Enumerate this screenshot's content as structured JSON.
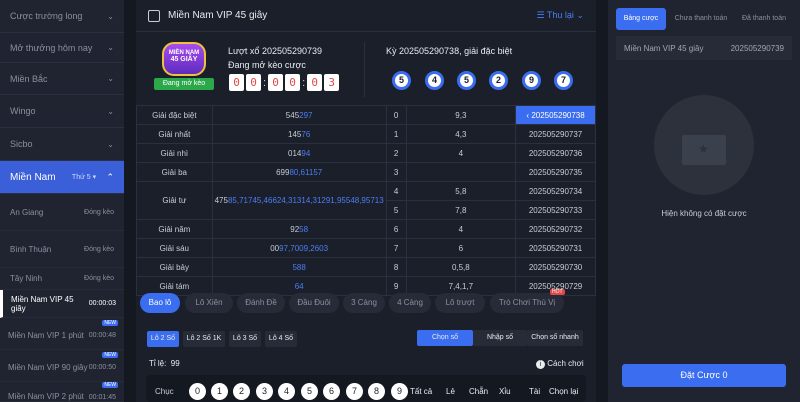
{
  "sidebar": {
    "items": [
      {
        "label": "Cược trường long"
      },
      {
        "label": "Mở thưởng hôm nay"
      },
      {
        "label": "Miền Bắc"
      },
      {
        "label": "Wingo"
      },
      {
        "label": "Sicbo"
      }
    ],
    "active": {
      "label": "Miền Nam",
      "day": "Thứ 5"
    },
    "provinces": [
      {
        "label": "An Giang",
        "status": "Đóng kèo"
      },
      {
        "label": "Bình Thuận",
        "status": "Đóng kèo"
      },
      {
        "label": "Tây Ninh",
        "status": "Đóng kèo"
      }
    ],
    "vip": [
      {
        "label": "Miền Nam VIP 45 giây",
        "time": "00:00:03",
        "badge": ""
      },
      {
        "label": "Miền Nam VIP 1 phút",
        "time": "00:00:48",
        "badge": "NEW"
      },
      {
        "label": "Miền Nam VIP 90 giây",
        "time": "00:00:50",
        "badge": "NEW"
      },
      {
        "label": "Miền Nam VIP 2 phút",
        "time": "00:01:45",
        "badge": "NEW"
      }
    ]
  },
  "header": {
    "title": "Miền Nam VIP 45 giây",
    "history": "Thu lại"
  },
  "draw": {
    "logo_line1": "MIỀN NAM",
    "logo_line2": "45 GIÂY",
    "status": "Đang mở kèo",
    "round": "Lượt xổ 202505290739",
    "round_status": "Đang mở kèo cược",
    "countdown": [
      "0",
      "0",
      "0",
      "0",
      "0",
      "3"
    ],
    "prev_round": "Kỳ 202505290738, giải đặc biệt",
    "balls": [
      "5",
      "4",
      "5",
      "2",
      "9",
      "7"
    ]
  },
  "results": [
    {
      "prize": "Giải đặc biệt",
      "plain": "545",
      "hl": "297",
      "head": "0",
      "tail": "9,3",
      "period": "202505290738",
      "active": true
    },
    {
      "prize": "Giải nhất",
      "plain": "145",
      "hl": "76",
      "head": "1",
      "tail": "4,3",
      "period": "202505290737"
    },
    {
      "prize": "Giải nhì",
      "plain": "014",
      "hl": "94",
      "head": "2",
      "tail": "4",
      "period": "202505290736"
    },
    {
      "prize": "Giải ba",
      "plain": "699",
      "hl": "80,61157",
      "head": "3",
      "tail": "",
      "period": "202505290735"
    },
    {
      "prize": "Giải tư",
      "plain": "475",
      "hl": "85,71745,46624,31314,31291,95548,95713",
      "head": "4",
      "tail": "5,8",
      "period": "202505290734",
      "head2": "5",
      "tail2": "7,8",
      "period2": "202505290733"
    },
    {
      "prize": "Giải năm",
      "plain": "92",
      "hl": "58",
      "head": "6",
      "tail": "4",
      "period": "202505290732"
    },
    {
      "prize": "Giải sáu",
      "plain": "00",
      "hl": "97,7009,2603",
      "head": "7",
      "tail": "6",
      "period": "202505290731"
    },
    {
      "prize": "Giải bảy",
      "plain": "",
      "hl": "588",
      "head": "8",
      "tail": "0,5,8",
      "period": "202505290730"
    },
    {
      "prize": "Giải tám",
      "plain": "",
      "hl": "64",
      "head": "9",
      "tail": "7,4,1,7",
      "period": "202505290729"
    }
  ],
  "game_tabs": [
    "Bao lô",
    "Lô Xiên",
    "Đánh Đề",
    "Đầu Đuôi",
    "3 Càng",
    "4 Càng",
    "Lô trượt",
    "Trò Chơi Thú Vị"
  ],
  "hot_badge": "HOT",
  "sub_tabs": [
    "Lô 2 Số",
    "Lô 2 Số 1K",
    "Lô 3 Số",
    "Lô 4 Số"
  ],
  "mode_tabs": [
    "Chọn số",
    "Nhập số",
    "Chọn số nhanh"
  ],
  "odds": "Tỉ lệ:  99",
  "how_to": "Cách chơi",
  "picker": {
    "row_label": "Chục",
    "digits": [
      "0",
      "1",
      "2",
      "3",
      "4",
      "5",
      "6",
      "7",
      "8",
      "9"
    ],
    "filters": [
      "Tất cả",
      "Lẻ",
      "Chẵn",
      "Xỉu",
      "Tài",
      "Chọn lại"
    ]
  },
  "right": {
    "tabs": [
      "Bảng cược",
      "Chưa thanh toán",
      "Đã thanh toán"
    ],
    "game": "Miền Nam VIP 45 giây",
    "period": "202505290739",
    "empty": "Hiện không có đặt cược",
    "place": "Đặt Cược 0"
  },
  "colors": {
    "accent": "#3a6df0",
    "bg": "#141821",
    "panel": "#1f2430",
    "countdown": "#e04848"
  }
}
